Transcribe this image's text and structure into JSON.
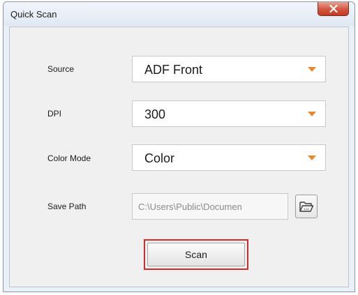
{
  "window": {
    "title": "Quick Scan",
    "close_label": "X"
  },
  "form": {
    "source": {
      "label": "Source",
      "value": "ADF Front"
    },
    "dpi": {
      "label": "DPI",
      "value": "300"
    },
    "color_mode": {
      "label": "Color Mode",
      "value": "Color"
    },
    "save_path": {
      "label": "Save Path",
      "value": "C:\\Users\\Public\\Documen"
    }
  },
  "actions": {
    "scan_label": "Scan"
  },
  "colors": {
    "dropdown_arrow": "#e8892f",
    "scan_highlight": "#d32b2b",
    "close_button": "#c8472f"
  },
  "icons": {
    "browse": "folder-open-icon",
    "close": "close-icon",
    "dropdown": "chevron-down-icon"
  }
}
